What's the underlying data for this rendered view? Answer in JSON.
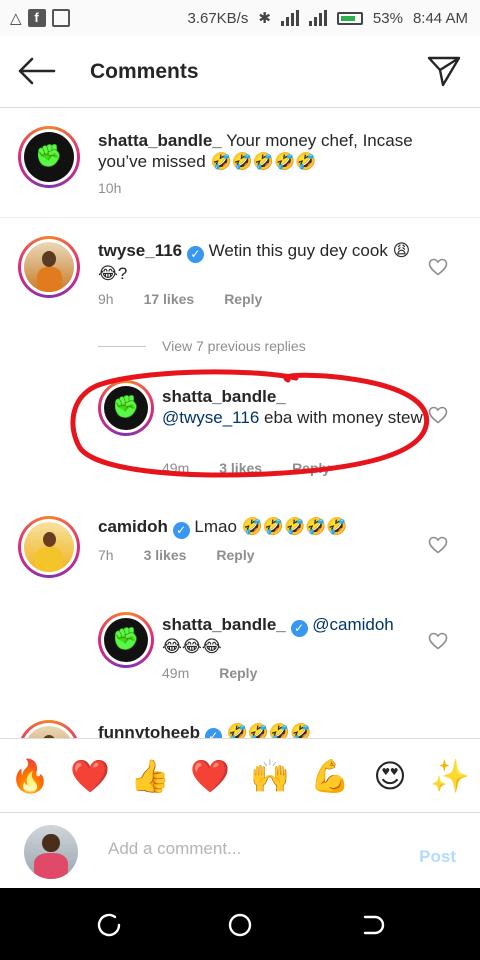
{
  "status_bar": {
    "net_speed": "3.67KB/s",
    "battery": "53%",
    "time": "8:44 AM"
  },
  "header": {
    "title": "Comments"
  },
  "comments": [
    {
      "username": "shatta_bandle_",
      "text": "Your money chef, Incase you’ve missed",
      "emojis": "🤣🤣🤣🤣🤣",
      "time": "10h"
    },
    {
      "username": "twyse_116",
      "verified": true,
      "text": "Wetin this guy dey cook",
      "emojis": "😩😂",
      "suffix": "?",
      "time": "9h",
      "likes": "17 likes",
      "reply": "Reply"
    },
    {
      "view_previous": "View 7 previous replies"
    },
    {
      "username": "shatta_bandle_",
      "mention": "@twyse_116",
      "text": "eba with money stew",
      "time": "49m",
      "likes": "3 likes",
      "reply": "Reply"
    },
    {
      "username": "camidoh",
      "verified": true,
      "text": "Lmao",
      "emojis": "🤣🤣🤣🤣🤣",
      "time": "7h",
      "likes": "3 likes",
      "reply": "Reply"
    },
    {
      "username": "shatta_bandle_",
      "verified": true,
      "mention": "@camidoh",
      "emojis": "😂😂😂",
      "time": "49m",
      "reply": "Reply"
    },
    {
      "username": "funnytoheeb",
      "verified": true,
      "emojis": "🤣🤣🤣🤣"
    }
  ],
  "emoji_bar": [
    "🔥",
    "❤️",
    "👍",
    "❤️",
    "🙌",
    "💪",
    "😍",
    "✨"
  ],
  "input": {
    "placeholder": "Add a comment...",
    "post_label": "Post"
  },
  "colors": {
    "verified": "#3897f0",
    "mention": "#003569",
    "meta": "#8e8e8e",
    "post_disabled": "#b3dbff",
    "annotation_red": "#e8141c"
  }
}
